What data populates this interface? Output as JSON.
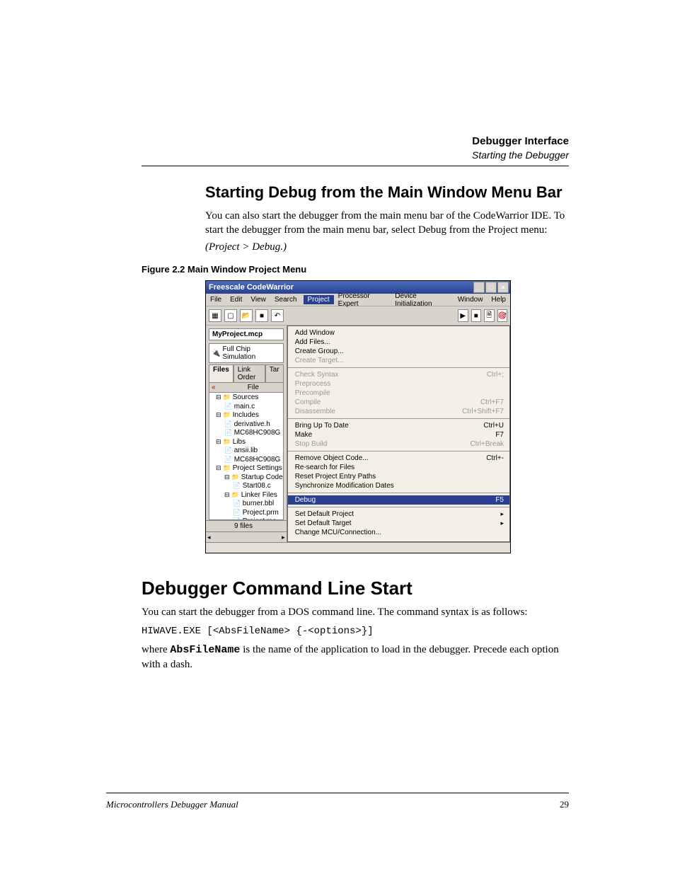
{
  "header": {
    "title": "Debugger Interface",
    "subtitle": "Starting the Debugger"
  },
  "section1": {
    "heading": "Starting Debug from the Main Window Menu Bar",
    "para": "You can also start the debugger from the main menu bar of the CodeWarrior IDE. To start the debugger from the main menu bar, select Debug from the Project menu:",
    "path": "(Project > Debug.)",
    "figcap": "Figure 2.2  Main Window Project Menu"
  },
  "screenshot": {
    "title": "Freescale CodeWarrior",
    "menubar": [
      "File",
      "Edit",
      "View",
      "Search",
      "Project",
      "Processor Expert",
      "Device Initialization",
      "Window",
      "Help"
    ],
    "project_name": "MyProject.mcp",
    "target": "Full Chip Simulation",
    "tabs": [
      "Files",
      "Link Order",
      "Tar"
    ],
    "col_file": "File",
    "tree": [
      {
        "lvl": 1,
        "type": "folder",
        "label": "Sources"
      },
      {
        "lvl": 2,
        "type": "file",
        "label": "main.c"
      },
      {
        "lvl": 1,
        "type": "folder",
        "label": "Includes"
      },
      {
        "lvl": 2,
        "type": "file",
        "label": "derivative.h"
      },
      {
        "lvl": 2,
        "type": "file",
        "label": "MC68HC908G"
      },
      {
        "lvl": 1,
        "type": "folder",
        "label": "Libs"
      },
      {
        "lvl": 2,
        "type": "file",
        "label": "ansii.lib"
      },
      {
        "lvl": 2,
        "type": "file",
        "label": "MC68HC908G"
      },
      {
        "lvl": 1,
        "type": "folder",
        "label": "Project Settings"
      },
      {
        "lvl": 2,
        "type": "folder",
        "label": "Startup Code"
      },
      {
        "lvl": 3,
        "type": "file",
        "label": "Start08.c"
      },
      {
        "lvl": 2,
        "type": "folder",
        "label": "Linker Files"
      },
      {
        "lvl": 3,
        "type": "file",
        "label": "burner.bbl"
      },
      {
        "lvl": 3,
        "type": "file",
        "label": "Project.prm"
      },
      {
        "lvl": 3,
        "type": "file",
        "label": "Project.ma"
      }
    ],
    "filecount": "9 files",
    "menu": [
      [
        {
          "label": "Add Window",
          "sc": "",
          "dis": false
        },
        {
          "label": "Add Files...",
          "sc": "",
          "dis": false
        },
        {
          "label": "Create Group...",
          "sc": "",
          "dis": false
        },
        {
          "label": "Create Target...",
          "sc": "",
          "dis": true
        }
      ],
      [
        {
          "label": "Check Syntax",
          "sc": "Ctrl+;",
          "dis": true
        },
        {
          "label": "Preprocess",
          "sc": "",
          "dis": true
        },
        {
          "label": "Precompile",
          "sc": "",
          "dis": true
        },
        {
          "label": "Compile",
          "sc": "Ctrl+F7",
          "dis": true
        },
        {
          "label": "Disassemble",
          "sc": "Ctrl+Shift+F7",
          "dis": true
        }
      ],
      [
        {
          "label": "Bring Up To Date",
          "sc": "Ctrl+U",
          "dis": false
        },
        {
          "label": "Make",
          "sc": "F7",
          "dis": false
        },
        {
          "label": "Stop Build",
          "sc": "Ctrl+Break",
          "dis": true
        }
      ],
      [
        {
          "label": "Remove Object Code...",
          "sc": "Ctrl+-",
          "dis": false
        },
        {
          "label": "Re-search for Files",
          "sc": "",
          "dis": false
        },
        {
          "label": "Reset Project Entry Paths",
          "sc": "",
          "dis": false
        },
        {
          "label": "Synchronize Modification Dates",
          "sc": "",
          "dis": false
        }
      ],
      [
        {
          "label": "Debug",
          "sc": "F5",
          "dis": false,
          "sel": true
        }
      ],
      [
        {
          "label": "Set Default Project",
          "sc": "",
          "dis": false,
          "sub": true
        },
        {
          "label": "Set Default Target",
          "sc": "",
          "dis": false,
          "sub": true
        },
        {
          "label": "Change MCU/Connection...",
          "sc": "",
          "dis": false
        }
      ]
    ]
  },
  "section2": {
    "heading": "Debugger Command Line Start",
    "para1": "You can start the debugger from a DOS command line. The command syntax is as follows:",
    "code": "HIWAVE.EXE [<AbsFileName> {-<options>}]",
    "para2a": "where ",
    "para2bold": "AbsFileName",
    "para2b": " is the name of the application to load in the debugger. Precede each option with a dash."
  },
  "footer": {
    "left": "Microcontrollers Debugger Manual",
    "right": "29"
  }
}
